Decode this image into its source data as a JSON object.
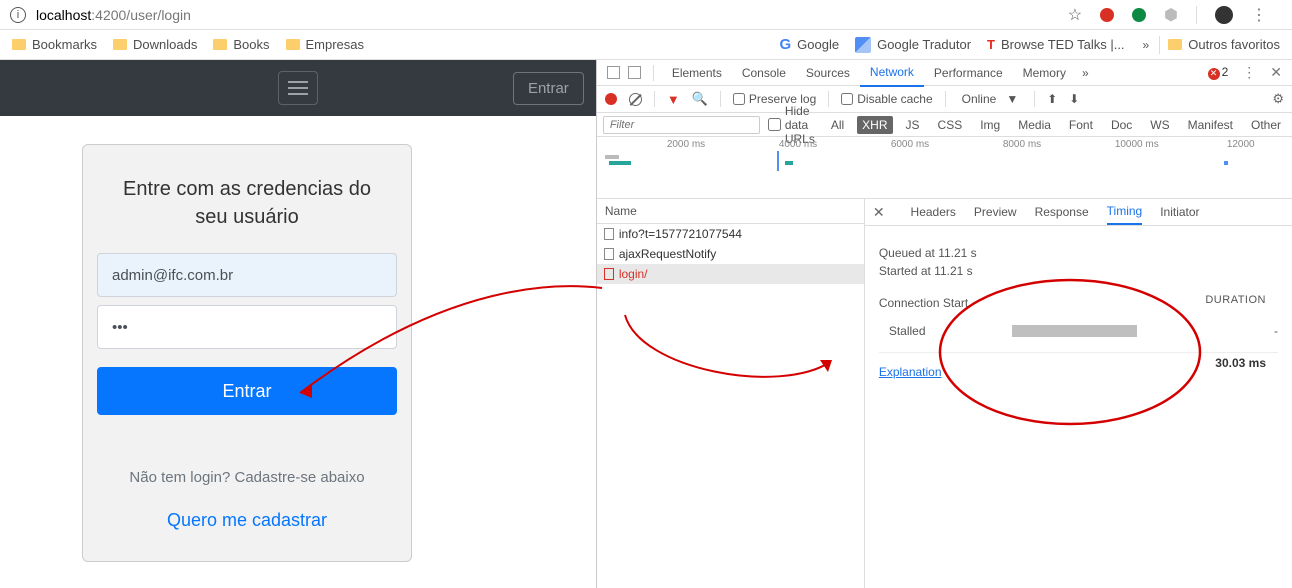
{
  "url": {
    "host": "localhost",
    "port_path": ":4200/user/login"
  },
  "bookmarks": {
    "left": [
      "Bookmarks",
      "Downloads",
      "Books",
      "Empresas"
    ],
    "right_google": "Google",
    "right_tradutor": "Google Tradutor",
    "right_ted": "Browse TED Talks |...",
    "right_outros": "Outros favoritos"
  },
  "navbar": {
    "entrar": "Entrar"
  },
  "login": {
    "title": "Entre com as credencias do seu usuário",
    "email_value": "admin@ifc.com.br",
    "password_value": "•••",
    "submit": "Entrar",
    "no_login": "Não tem login? Cadastre-se abaixo",
    "register_link": "Quero me cadastrar"
  },
  "devtools": {
    "tabs": [
      "Elements",
      "Console",
      "Sources",
      "Network",
      "Performance",
      "Memory"
    ],
    "active_tab": "Network",
    "error_count": "2",
    "preserve_log": "Preserve log",
    "disable_cache": "Disable cache",
    "online": "Online",
    "filter_placeholder": "Filter",
    "hide_urls": "Hide data URLs",
    "ftypes": [
      "All",
      "XHR",
      "JS",
      "CSS",
      "Img",
      "Media",
      "Font",
      "Doc",
      "WS",
      "Manifest",
      "Other"
    ],
    "ftype_active": "XHR",
    "timeline_marks": [
      "2000 ms",
      "4000 ms",
      "6000 ms",
      "8000 ms",
      "10000 ms",
      "12000"
    ],
    "name_header": "Name",
    "requests": [
      {
        "name": "info?t=1577721077544",
        "err": false
      },
      {
        "name": "ajaxRequestNotify",
        "err": false
      },
      {
        "name": "login/",
        "err": true
      }
    ],
    "detail_tabs": [
      "Headers",
      "Preview",
      "Response",
      "Timing",
      "Initiator"
    ],
    "detail_active": "Timing",
    "queued": "Queued at 11.21 s",
    "started": "Started at 11.21 s",
    "conn_start": "Connection Start",
    "stalled": "Stalled",
    "duration_label": "DURATION",
    "dash": "-",
    "explanation": "Explanation",
    "total": "30.03 ms"
  }
}
